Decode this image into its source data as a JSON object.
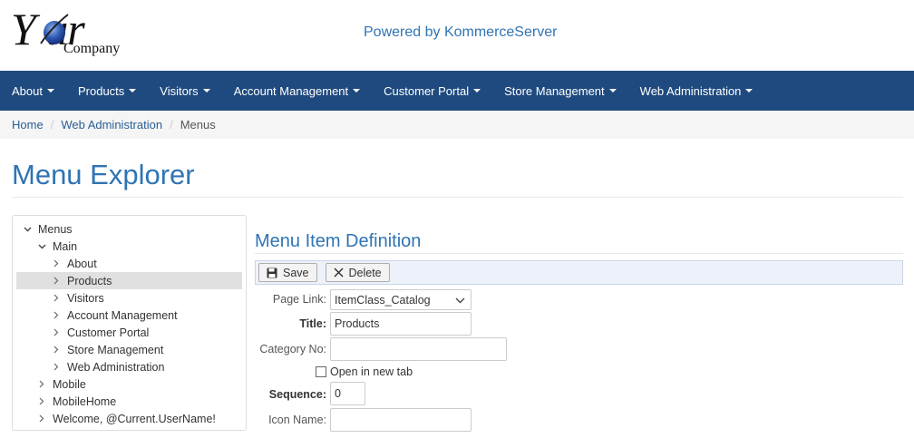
{
  "header": {
    "logo_your": "Y  ur",
    "logo_company": "Company",
    "powered_by": "Powered by KommerceServer"
  },
  "navbar": {
    "items": [
      {
        "label": "About"
      },
      {
        "label": "Products"
      },
      {
        "label": "Visitors"
      },
      {
        "label": "Account Management"
      },
      {
        "label": "Customer Portal"
      },
      {
        "label": "Store Management"
      },
      {
        "label": "Web Administration"
      }
    ]
  },
  "breadcrumb": {
    "home": "Home",
    "web_admin": "Web Administration",
    "current": "Menus",
    "separator": "/"
  },
  "page": {
    "title": "Menu Explorer"
  },
  "tree": {
    "items": [
      {
        "label": "Menus",
        "chevron": "down"
      },
      {
        "label": "Main",
        "chevron": "down"
      },
      {
        "label": "About",
        "chevron": "right"
      },
      {
        "label": "Products",
        "chevron": "right",
        "selected": true
      },
      {
        "label": "Visitors",
        "chevron": "right"
      },
      {
        "label": "Account Management",
        "chevron": "right"
      },
      {
        "label": "Customer Portal",
        "chevron": "right"
      },
      {
        "label": "Store Management",
        "chevron": "right"
      },
      {
        "label": "Web Administration",
        "chevron": "right"
      },
      {
        "label": "Mobile",
        "chevron": "right"
      },
      {
        "label": "MobileHome",
        "chevron": "right"
      },
      {
        "label": "Welcome, @Current.UserName!",
        "chevron": "right"
      }
    ]
  },
  "form": {
    "section_title": "Menu Item Definition",
    "save_label": "Save",
    "delete_label": "Delete",
    "page_link_label": "Page Link:",
    "page_link_value": "ItemClass_Catalog",
    "title_label": "Title:",
    "title_value": "Products",
    "category_label": "Category No:",
    "category_value": "",
    "open_new_tab_label": "Open in new tab",
    "open_new_tab_checked": false,
    "sequence_label": "Sequence:",
    "sequence_value": "0",
    "icon_label": "Icon Name:",
    "icon_value": ""
  },
  "colors": {
    "brand_blue": "#2f74b4",
    "navbar": "#1f4a7f"
  }
}
